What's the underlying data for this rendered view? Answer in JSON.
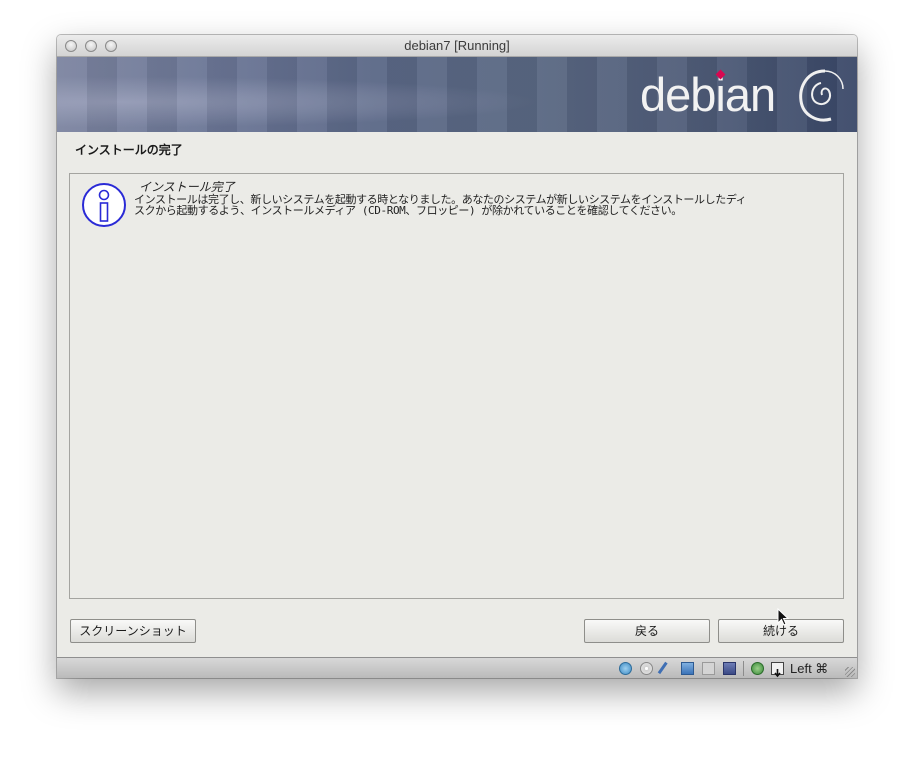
{
  "window": {
    "title": "debian7 [Running]"
  },
  "banner": {
    "wordmark": "debian"
  },
  "page": {
    "section_title": "インストールの完了"
  },
  "message": {
    "heading": "インストール完了",
    "body_line1": "インストールは完了し、新しいシステムを起動する時となりました。あなたのシステムが新しいシステムをインストールしたディ",
    "body_line2": "スクから起動するよう、インストールメディア (CD-ROM、フロッピー) が除かれていることを確認してください。"
  },
  "buttons": {
    "screenshot": "スクリーンショット",
    "back": "戻る",
    "continue": "続ける"
  },
  "statusbar": {
    "host_key": "Left ⌘",
    "icons": [
      "hard-disk-icon",
      "optical-drive-icon",
      "usb-icon",
      "network-icon",
      "shared-folder-icon",
      "display-icon",
      "capture-icon",
      "mouse-integration-icon"
    ]
  },
  "colors": {
    "debian_red": "#d70751",
    "banner_dark": "#3a4868"
  }
}
